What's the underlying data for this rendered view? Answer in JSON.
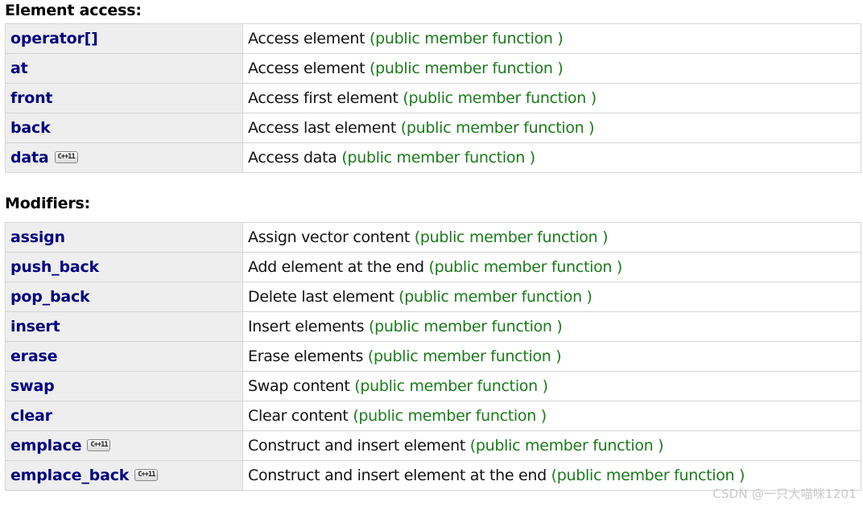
{
  "sections": [
    {
      "heading": "Element access:",
      "rows": [
        {
          "name": "operator[]",
          "badge": "",
          "desc": "Access element ",
          "note": "(public member function )"
        },
        {
          "name": "at",
          "badge": "",
          "desc": "Access element ",
          "note": "(public member function )"
        },
        {
          "name": "front",
          "badge": "",
          "desc": "Access first element ",
          "note": "(public member function )"
        },
        {
          "name": "back",
          "badge": "",
          "desc": "Access last element ",
          "note": "(public member function )"
        },
        {
          "name": "data",
          "badge": "C++11",
          "desc": "Access data ",
          "note": "(public member function )"
        }
      ]
    },
    {
      "heading": "Modifiers:",
      "rows": [
        {
          "name": "assign",
          "badge": "",
          "desc": "Assign vector content ",
          "note": "(public member function )"
        },
        {
          "name": "push_back",
          "badge": "",
          "desc": "Add element at the end ",
          "note": "(public member function )"
        },
        {
          "name": "pop_back",
          "badge": "",
          "desc": "Delete last element ",
          "note": "(public member function )"
        },
        {
          "name": "insert",
          "badge": "",
          "desc": "Insert elements ",
          "note": "(public member function )"
        },
        {
          "name": "erase",
          "badge": "",
          "desc": "Erase elements ",
          "note": "(public member function )"
        },
        {
          "name": "swap",
          "badge": "",
          "desc": "Swap content ",
          "note": "(public member function )"
        },
        {
          "name": "clear",
          "badge": "",
          "desc": "Clear content ",
          "note": "(public member function )"
        },
        {
          "name": "emplace",
          "badge": "C++11",
          "desc": "Construct and insert element ",
          "note": "(public member function )"
        },
        {
          "name": "emplace_back",
          "badge": "C++11",
          "desc": "Construct and insert element at the end ",
          "note": "(public member function )"
        }
      ]
    }
  ],
  "watermark": "CSDN @一只大喵咪1201",
  "colors": {
    "link": "#000080",
    "note": "#1a7a1a",
    "name_cell_bg": "#eeeeee",
    "border": "#d5d5d5",
    "watermark": "#c9c9c9"
  }
}
